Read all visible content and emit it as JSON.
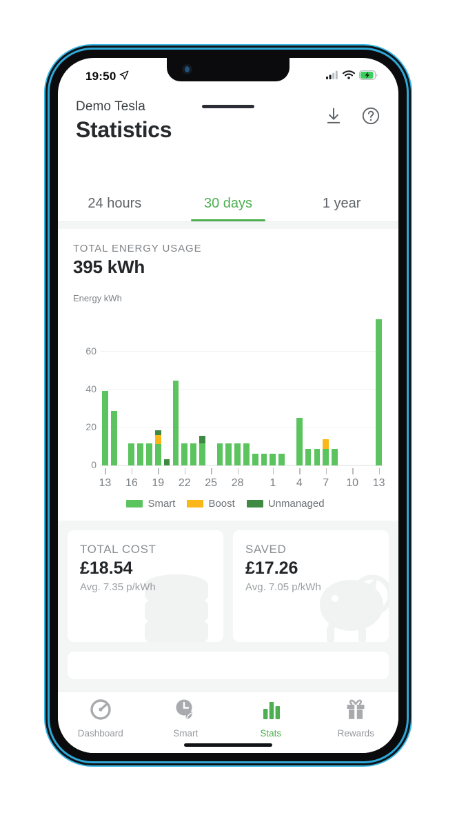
{
  "statusbar": {
    "time": "19:50",
    "location_icon": "location-arrow-icon",
    "cellular_icon": "cellular-bars-icon",
    "wifi_icon": "wifi-icon",
    "battery_icon": "battery-charging-icon"
  },
  "header": {
    "subtitle": "Demo Tesla",
    "title": "Statistics",
    "download_icon": "download-icon",
    "help_icon": "help-circle-icon"
  },
  "tabs": [
    {
      "label": "24 hours",
      "active": false
    },
    {
      "label": "30 days",
      "active": true
    },
    {
      "label": "1 year",
      "active": false
    }
  ],
  "summary": {
    "label": "TOTAL ENERGY USAGE",
    "value": "395 kWh"
  },
  "colors": {
    "accent": "#4caf50",
    "smart": "#5cc45f",
    "boost": "#f9b719",
    "unmanaged": "#3f8a43",
    "text_dark": "#232629",
    "text_muted": "#808488",
    "screen_bg": "#f4f5f5"
  },
  "chart_data": {
    "type": "bar",
    "title": "",
    "subtitle": "",
    "xlabel": "",
    "ylabel": "Energy kWh",
    "ylim": [
      0,
      80
    ],
    "yticks": [
      0,
      20,
      40,
      60
    ],
    "grid": true,
    "stacked": true,
    "legend_position": "bottom",
    "legend": [
      "Smart",
      "Boost",
      "Unmanaged"
    ],
    "categories": [
      "13",
      "14",
      "15",
      "16",
      "17",
      "18",
      "19",
      "20",
      "21",
      "22",
      "23",
      "24",
      "25",
      "26",
      "27",
      "28",
      "29",
      "30",
      "31",
      "1",
      "2",
      "3",
      "4",
      "5",
      "6",
      "7",
      "8",
      "9",
      "10",
      "11",
      "12",
      "13"
    ],
    "xtick_labels": [
      "13",
      "16",
      "19",
      "22",
      "25",
      "28",
      "1",
      "4",
      "7",
      "10",
      "13"
    ],
    "xtick_indices": [
      0,
      3,
      6,
      9,
      12,
      15,
      19,
      22,
      25,
      28,
      31
    ],
    "series": [
      {
        "name": "Smart",
        "color": "#5cc45f",
        "values": [
          39,
          28.5,
          0,
          11.5,
          11.5,
          11.5,
          11,
          0,
          44.5,
          11.5,
          11.5,
          11.5,
          0,
          11.5,
          11.5,
          11.5,
          11.5,
          6,
          6,
          6,
          6,
          0,
          25,
          8.5,
          8.5,
          8.5,
          8.5,
          0,
          0,
          0,
          0,
          77
        ]
      },
      {
        "name": "Boost",
        "color": "#f9b719",
        "values": [
          0,
          0,
          0,
          0,
          0,
          0,
          5,
          0,
          0,
          0,
          0,
          0,
          0,
          0,
          0,
          0,
          0,
          0,
          0,
          0,
          0,
          0,
          0,
          0,
          0,
          5,
          0,
          0,
          0,
          0,
          0,
          0
        ]
      },
      {
        "name": "Unmanaged",
        "color": "#3f8a43",
        "values": [
          0,
          0,
          0,
          0,
          0,
          0,
          2.5,
          3,
          0,
          0,
          0,
          4,
          0,
          0,
          0,
          0,
          0,
          0,
          0,
          0,
          0,
          0,
          0,
          0,
          0,
          0,
          0,
          0,
          0,
          0,
          0,
          0
        ]
      }
    ]
  },
  "cost_cards": [
    {
      "label": "TOTAL COST",
      "value": "£18.54",
      "sub": "Avg. 7.35 p/kWh",
      "watermark_icon": "coin-stack-icon"
    },
    {
      "label": "SAVED",
      "value": "£17.26",
      "sub": "Avg. 7.05 p/kWh",
      "watermark_icon": "piggy-bank-icon"
    }
  ],
  "bottom_nav": [
    {
      "label": "Dashboard",
      "icon": "gauge-icon",
      "active": false
    },
    {
      "label": "Smart",
      "icon": "clock-leaf-icon",
      "active": false
    },
    {
      "label": "Stats",
      "icon": "bar-chart-icon",
      "active": true
    },
    {
      "label": "Rewards",
      "icon": "gift-icon",
      "active": false
    }
  ]
}
